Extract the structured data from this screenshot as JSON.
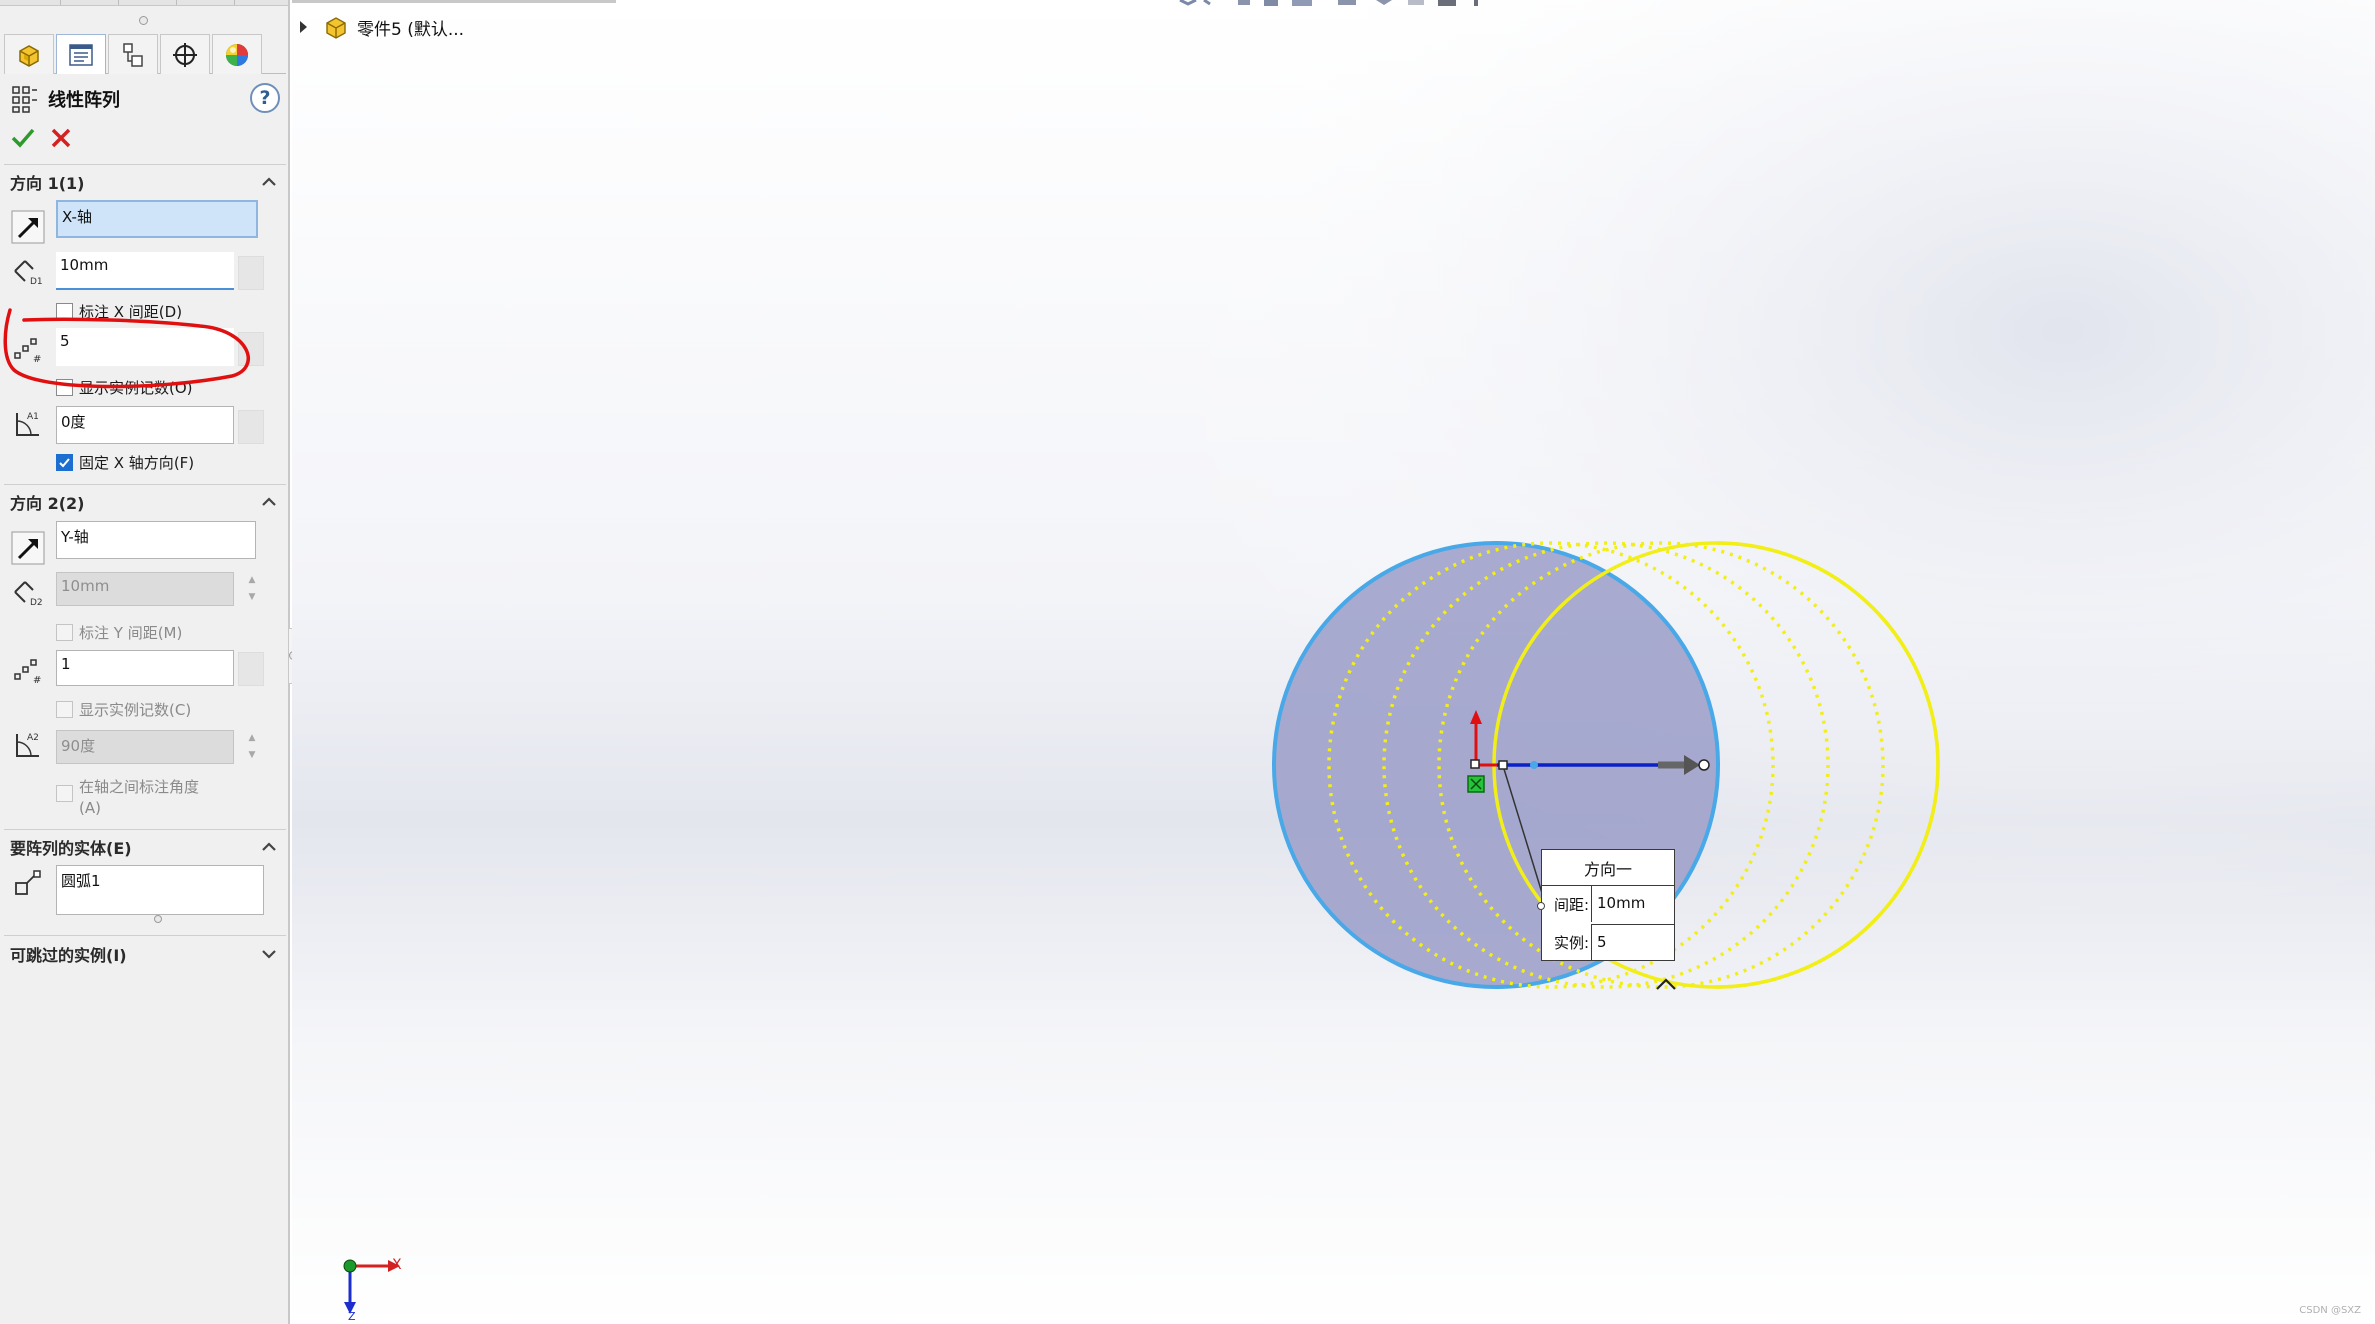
{
  "feature": {
    "title": "线性阵列"
  },
  "direction1": {
    "header": "方向 1(1)",
    "axis_value": "X-轴",
    "spacing_value": "10mm",
    "dimension_spacing_label": "标注 X 间距(D)",
    "dimension_spacing_checked": false,
    "instances_value": "5",
    "show_count_label": "显示实例记数(O)",
    "show_count_checked": false,
    "angle_value": "0度",
    "fix_axis_label": "固定 X 轴方向(F)",
    "fix_axis_checked": true
  },
  "direction2": {
    "header": "方向 2(2)",
    "axis_value": "Y-轴",
    "spacing_value": "10mm",
    "dimension_spacing_label": "标注 Y 间距(M)",
    "instances_value": "1",
    "show_count_label": "显示实例记数(C)",
    "angle_value": "90度",
    "angle_between_label_line1": "在轴之间标注角度",
    "angle_between_label_line2": "(A)"
  },
  "entities": {
    "header": "要阵列的实体(E)",
    "value": "圆弧1"
  },
  "skip_instances": {
    "header": "可跳过的实例(I)"
  },
  "tree": {
    "part_name": "零件5 (默认..."
  },
  "callout": {
    "title": "方向一",
    "spacing_label": "间距:",
    "spacing_value": "10mm",
    "instances_label": "实例:",
    "instances_value": "5"
  },
  "triad": {
    "x_label": "X",
    "z_label": "Z"
  },
  "watermark": "CSDN @SXZ",
  "colors": {
    "accent_blue": "#1c6fd0",
    "selected_field": "#cfe4f8",
    "pattern_yellow": "#f2ee18",
    "circle_fill": "#9a9cc8",
    "circle_outline": "#48a8e8",
    "annotation_red": "#e01010"
  }
}
